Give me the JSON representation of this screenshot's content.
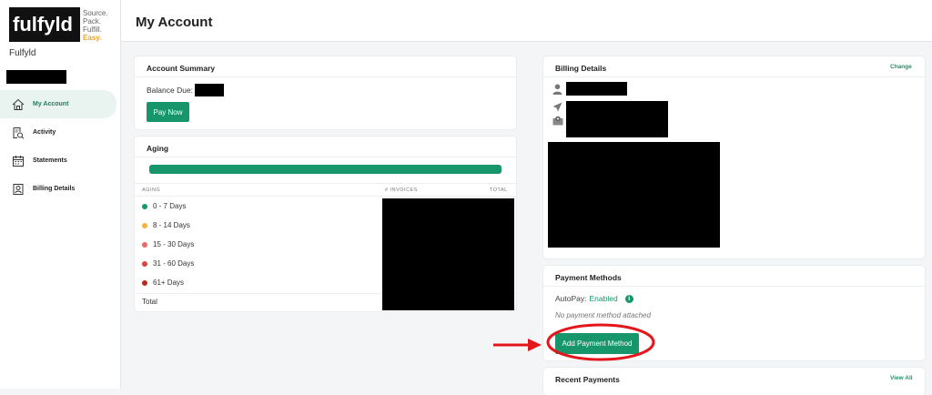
{
  "brand": {
    "logo_word": "fulfyld",
    "tagline": [
      "Source.",
      "Pack.",
      "Fulfill.",
      "Easy."
    ],
    "accent": "#f2a227"
  },
  "sidebar": {
    "org_name": "Fulfyld",
    "items": [
      {
        "label": "My Account",
        "icon": "home-icon",
        "active": true
      },
      {
        "label": "Activity",
        "icon": "activity-search-icon",
        "active": false
      },
      {
        "label": "Statements",
        "icon": "calendar-icon",
        "active": false
      },
      {
        "label": "Billing Details",
        "icon": "user-card-icon",
        "active": false
      }
    ]
  },
  "header": {
    "title": "My Account"
  },
  "account_summary": {
    "title": "Account Summary",
    "balance_label": "Balance Due:",
    "pay_button": "Pay Now"
  },
  "aging": {
    "title": "Aging",
    "progress_fraction": 1.0,
    "bar_color": "#17966b",
    "columns": [
      "AGING",
      "# INVOICES",
      "TOTAL"
    ],
    "rows": [
      {
        "label": "0 - 7 Days",
        "color": "#17966b"
      },
      {
        "label": "8 - 14 Days",
        "color": "#f2b43c"
      },
      {
        "label": "15 - 30 Days",
        "color": "#e46a6a"
      },
      {
        "label": "31 - 60 Days",
        "color": "#d9473b"
      },
      {
        "label": "61+ Days",
        "color": "#b82a20"
      }
    ],
    "total_label": "Total"
  },
  "billing_details": {
    "title": "Billing Details",
    "change_link": "Change",
    "icons": [
      "person-icon",
      "send-icon",
      "map-pin-icon"
    ]
  },
  "payment_methods": {
    "title": "Payment Methods",
    "autopay_label": "AutoPay:",
    "autopay_value": "Enabled",
    "empty_text": "No payment method attached",
    "add_button": "Add Payment Method"
  },
  "recent_payments": {
    "title": "Recent Payments",
    "view_all_link": "View All"
  },
  "annotation_color": "#e3161b"
}
